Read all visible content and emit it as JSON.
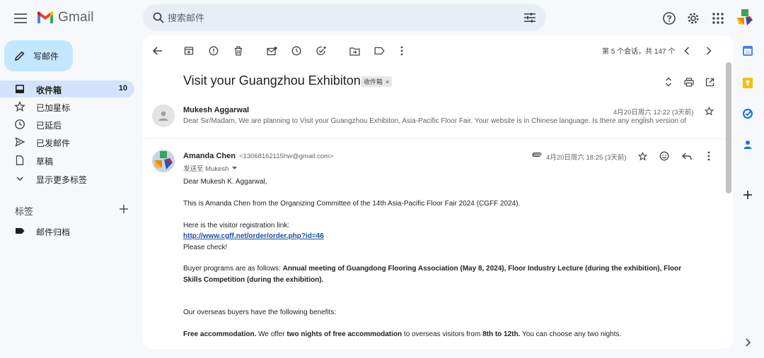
{
  "app": {
    "name": "Gmail"
  },
  "search": {
    "placeholder": "搜索邮件"
  },
  "compose": {
    "label": "写邮件"
  },
  "nav": [
    {
      "label": "收件箱",
      "count": "10",
      "active": true
    },
    {
      "label": "已加星标"
    },
    {
      "label": "已延后"
    },
    {
      "label": "已发邮件"
    },
    {
      "label": "草稿"
    },
    {
      "label": "显示更多标签"
    }
  ],
  "labels": {
    "heading": "标签",
    "items": [
      {
        "label": "邮件归档"
      }
    ]
  },
  "toolbar": {
    "pager": "第 5 个会话，共 147 个"
  },
  "thread": {
    "subject": "Visit your Guangzhou Exhibiton",
    "chip": "收件箱",
    "chip_close": "×"
  },
  "message1": {
    "sender": "Mukesh Aggarwal",
    "date": "4月20日周六 12:22 (3天前)",
    "snippet": "Dear Sir/Madam, We are planning to Visit your Guangzhou Exhibiton, Asia-Pacific Floor Fair. Your website is in Chinese language. Is there any english version of"
  },
  "message2": {
    "sender": "Amanda Chen",
    "email": "<13068162115hw@gmail.com>",
    "date": "4月20日周六 18:25 (3天前)",
    "to": "发送至 Mukesh",
    "greeting": "Dear Mukesh K. Aggarwal,",
    "intro": "This is Amanda Chen from the Organizing Committee of the 14th Asia-Pacific Floor Fair 2024 (CGFF 2024).",
    "link_intro": "Here is the visitor registration link:",
    "link": "http://www.cgff.net/order/order.php?id=46",
    "please_check": "Please check!",
    "buyer_prefix": "Buyer programs are as follows: ",
    "buyer_bold_1": "Annual meeting of Guangdong Flooring Association (May 8, 2024), Floor Industry Lecture (during the exhibition), Floor",
    "buyer_bold_2": "Skills Competition (during the exhibition).",
    "benefits_intro": "Our overseas buyers have the following benefits:",
    "benefit_bold_1": "Free accommodation.",
    "benefit_text_1": " We offer ",
    "benefit_bold_2": "two nights of free accommodation",
    "benefit_text_2": " to overseas visitors from ",
    "benefit_bold_3": "8th to 12th.",
    "benefit_text_3": " You can choose any two nights."
  },
  "colors": {
    "background": "#f6f8fc",
    "compose": "#c2e7ff",
    "active_nav": "#d3e3fd",
    "search": "#e9eef6",
    "link": "#1a4fa8"
  }
}
